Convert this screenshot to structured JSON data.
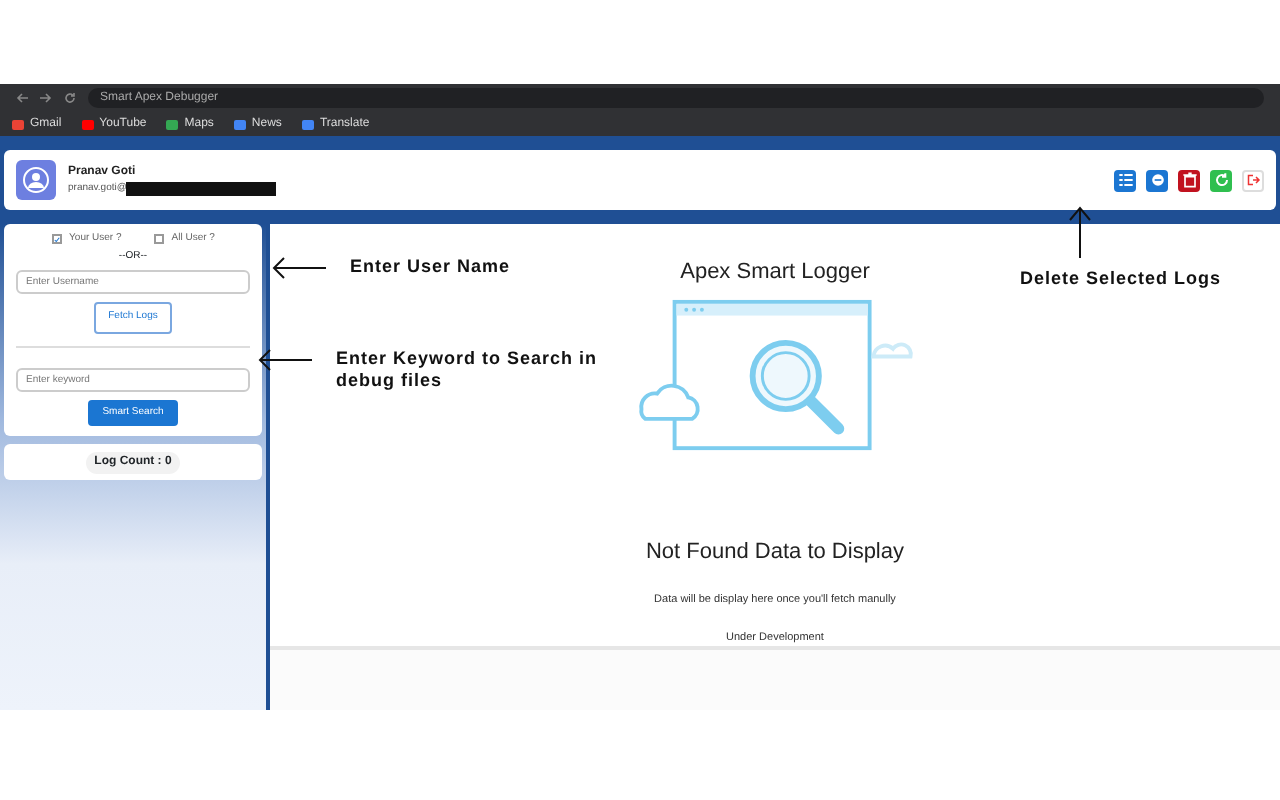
{
  "browser": {
    "tab_title": "Smart Apex Debugger",
    "bookmarks": [
      {
        "label": "Gmail",
        "color": "#ea4335"
      },
      {
        "label": "YouTube",
        "color": "#ff0000"
      },
      {
        "label": "Maps",
        "color": "#34a853"
      },
      {
        "label": "News",
        "color": "#4285f4"
      },
      {
        "label": "Translate",
        "color": "#4285f4"
      }
    ]
  },
  "user": {
    "name": "Pranav Goti",
    "email": "pranav.goti@"
  },
  "toolbar": [
    {
      "kind": "primary"
    },
    {
      "kind": "primary"
    },
    {
      "kind": "danger"
    },
    {
      "kind": "success"
    },
    {
      "kind": "light"
    }
  ],
  "filters": [
    {
      "label": "Your User ?",
      "checked": true
    },
    {
      "label": "All User ?",
      "checked": false
    }
  ],
  "separator": "--OR--",
  "username_field": {
    "placeholder": "Enter Username"
  },
  "fetch_button": "Fetch Logs",
  "keyword_field": {
    "placeholder": "Enter keyword"
  },
  "search_button": "Smart Search",
  "log_count": "Log Count : 0",
  "main": {
    "title": "Apex Smart Logger",
    "empty_title": "Not Found Data to Display",
    "empty_text": "Data will be display here once you'll fetch manully",
    "note": "Under Development"
  },
  "annotations": [
    {
      "kind": "left",
      "text": "Enter User Name"
    },
    {
      "kind": "left",
      "text": "Enter Keyword to Search in debug files"
    },
    {
      "kind": "up",
      "text": "Delete Selected Logs"
    }
  ]
}
